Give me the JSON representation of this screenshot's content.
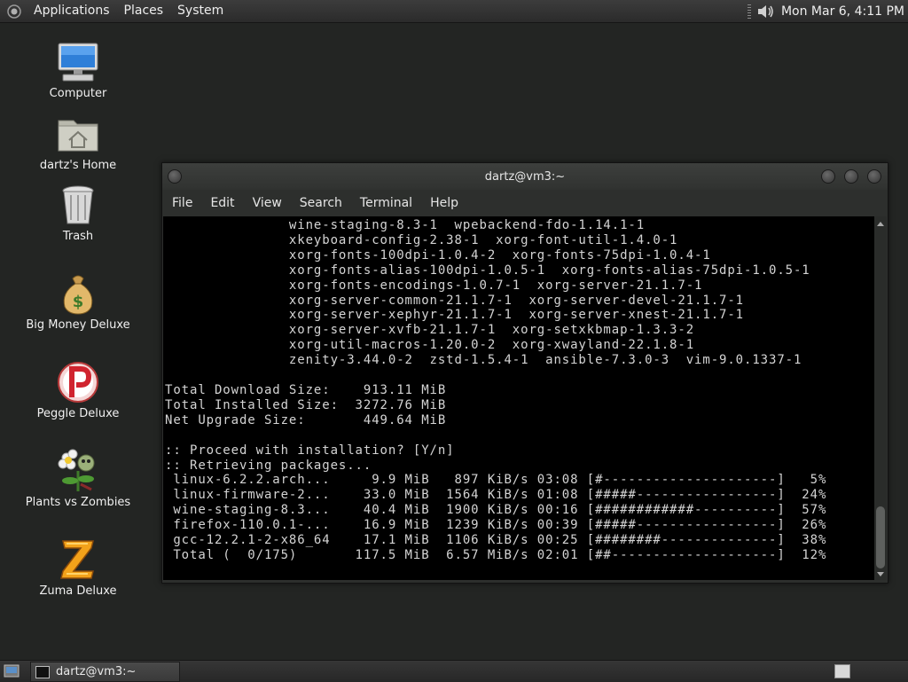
{
  "top_panel": {
    "menus": [
      "Applications",
      "Places",
      "System"
    ],
    "clock": "Mon Mar  6,  4:11 PM"
  },
  "desktop": {
    "icons": [
      {
        "label": "Computer",
        "icon": "computer-icon"
      },
      {
        "label": "dartz's Home",
        "icon": "home-folder-icon"
      },
      {
        "label": "Trash",
        "icon": "trash-icon"
      },
      {
        "label": "Big Money Deluxe",
        "icon": "money-bag-icon"
      },
      {
        "label": "Peggle Deluxe",
        "icon": "peggle-icon"
      },
      {
        "label": "Plants vs Zombies",
        "icon": "plants-vs-zombies-icon"
      },
      {
        "label": "Zuma Deluxe",
        "icon": "zuma-icon"
      }
    ]
  },
  "terminal": {
    "title": "dartz@vm3:~",
    "menus": [
      "File",
      "Edit",
      "View",
      "Search",
      "Terminal",
      "Help"
    ],
    "lines": [
      "               wine-staging-8.3-1  wpebackend-fdo-1.14.1-1",
      "               xkeyboard-config-2.38-1  xorg-font-util-1.4.0-1",
      "               xorg-fonts-100dpi-1.0.4-2  xorg-fonts-75dpi-1.0.4-1",
      "               xorg-fonts-alias-100dpi-1.0.5-1  xorg-fonts-alias-75dpi-1.0.5-1",
      "               xorg-fonts-encodings-1.0.7-1  xorg-server-21.1.7-1",
      "               xorg-server-common-21.1.7-1  xorg-server-devel-21.1.7-1",
      "               xorg-server-xephyr-21.1.7-1  xorg-server-xnest-21.1.7-1",
      "               xorg-server-xvfb-21.1.7-1  xorg-setxkbmap-1.3.3-2",
      "               xorg-util-macros-1.20.0-2  xorg-xwayland-22.1.8-1",
      "               zenity-3.44.0-2  zstd-1.5.4-1  ansible-7.3.0-3  vim-9.0.1337-1",
      "",
      "Total Download Size:    913.11 MiB",
      "Total Installed Size:  3272.76 MiB",
      "Net Upgrade Size:       449.64 MiB",
      "",
      ":: Proceed with installation? [Y/n]",
      ":: Retrieving packages...",
      " linux-6.2.2.arch...     9.9 MiB   897 KiB/s 03:08 [#---------------------]   5%",
      " linux-firmware-2...    33.0 MiB  1564 KiB/s 01:08 [#####-----------------]  24%",
      " wine-staging-8.3...    40.4 MiB  1900 KiB/s 00:16 [############----------]  57%",
      " firefox-110.0.1-...    16.9 MiB  1239 KiB/s 00:39 [#####-----------------]  26%",
      " gcc-12.2.1-2-x86_64    17.1 MiB  1106 KiB/s 00:25 [########--------------]  38%",
      " Total (  0/175)       117.5 MiB  6.57 MiB/s 02:01 [##--------------------]  12%"
    ]
  },
  "bottom_panel": {
    "task_label": "dartz@vm3:~"
  }
}
